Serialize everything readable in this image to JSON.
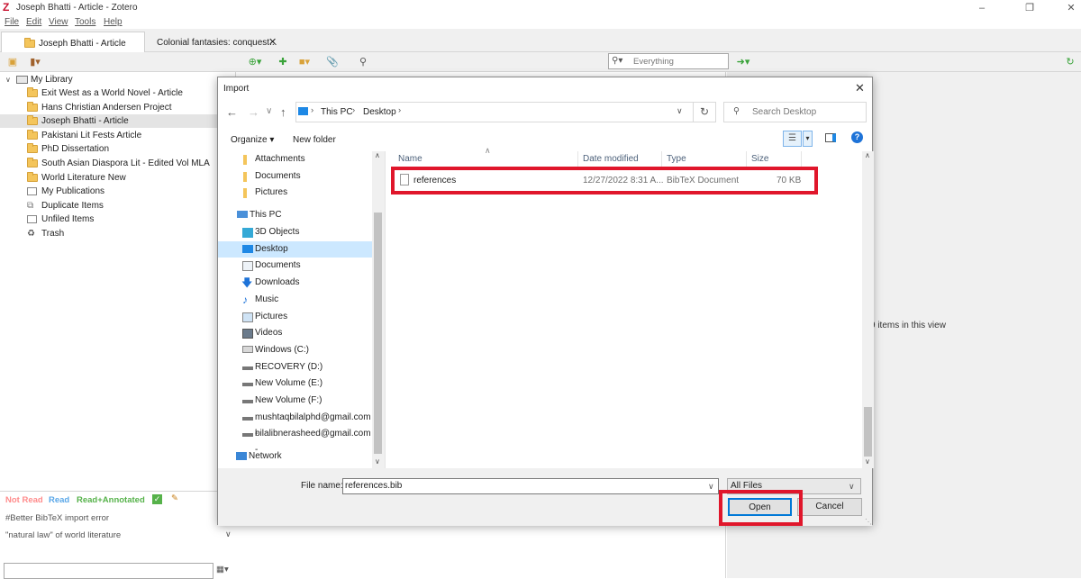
{
  "window": {
    "title": "Joseph Bhatti - Article - Zotero"
  },
  "menu": [
    "File",
    "Edit",
    "View",
    "Tools",
    "Help"
  ],
  "tabs": [
    {
      "label": "Joseph Bhatti - Article"
    },
    {
      "label": "Colonial fantasies: conquest..."
    }
  ],
  "toolbar": {
    "search_placeholder": "Everything"
  },
  "library": {
    "root": "My Library",
    "items": [
      {
        "label": "Exit West as a World Novel - Article"
      },
      {
        "label": "Hans Christian Andersen Project"
      },
      {
        "label": "Joseph Bhatti - Article"
      },
      {
        "label": "Pakistani Lit Fests Article"
      },
      {
        "label": "PhD Dissertation"
      },
      {
        "label": "South Asian Diaspora Lit - Edited Vol MLA"
      },
      {
        "label": "World Literature New"
      },
      {
        "label": "My Publications"
      },
      {
        "label": "Duplicate Items"
      },
      {
        "label": "Unfiled Items"
      },
      {
        "label": "Trash"
      }
    ]
  },
  "tags": {
    "colored": [
      {
        "label": "Not Read",
        "color": "#ff8c8c"
      },
      {
        "label": "Read",
        "color": "#5aa7e8"
      },
      {
        "label": "Read+Annotated",
        "color": "#56b24a"
      }
    ],
    "list": [
      "#Better BibTeX import error",
      "\"natural law\" of world literature"
    ]
  },
  "right_pane": {
    "status": "9 items in this view"
  },
  "dialog": {
    "title": "Import",
    "breadcrumb": [
      "This PC",
      "Desktop"
    ],
    "search_placeholder": "Search Desktop",
    "organize_label": "Organize",
    "new_folder_label": "New folder",
    "nav": [
      {
        "label": "Attachments",
        "icon": "folder-icon"
      },
      {
        "label": "Documents",
        "icon": "folder-icon"
      },
      {
        "label": "Pictures",
        "icon": "folder-icon"
      },
      {
        "label": "This PC",
        "icon": "pc-icon"
      },
      {
        "label": "3D Objects",
        "icon": "cube-icon"
      },
      {
        "label": "Desktop",
        "icon": "desktop-icon"
      },
      {
        "label": "Documents",
        "icon": "documents-icon"
      },
      {
        "label": "Downloads",
        "icon": "download-icon"
      },
      {
        "label": "Music",
        "icon": "music-icon"
      },
      {
        "label": "Pictures",
        "icon": "pictures-icon"
      },
      {
        "label": "Videos",
        "icon": "videos-icon"
      },
      {
        "label": "Windows (C:)",
        "icon": "drive-icon"
      },
      {
        "label": "RECOVERY (D:)",
        "icon": "drive-icon"
      },
      {
        "label": "New Volume (E:)",
        "icon": "drive-icon"
      },
      {
        "label": "New Volume (F:)",
        "icon": "drive-icon"
      },
      {
        "label": "mushtaqbilalphd@gmail.com -",
        "icon": "drive-icon"
      },
      {
        "label": "bilalibnerasheed@gmail.com -",
        "icon": "drive-icon"
      },
      {
        "label": "Network",
        "icon": "network-icon"
      }
    ],
    "columns": [
      "Name",
      "Date modified",
      "Type",
      "Size"
    ],
    "files": [
      {
        "name": "references",
        "date": "12/27/2022 8:31 A...",
        "type": "BibTeX Document",
        "size": "70 KB"
      }
    ],
    "file_name_label": "File name:",
    "file_name_value": "references.bib",
    "filter_value": "All Files",
    "open_label": "Open",
    "cancel_label": "Cancel"
  }
}
